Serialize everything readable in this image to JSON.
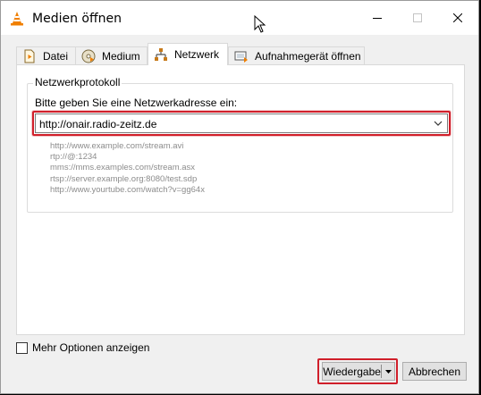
{
  "window": {
    "title": "Medien öffnen",
    "controls": {
      "minimize": "minimize-icon",
      "maximize": "maximize-icon",
      "close": "close-icon"
    }
  },
  "tabs": [
    {
      "label": "Datei",
      "icon": "file-icon",
      "selected": false
    },
    {
      "label": "Medium",
      "icon": "disc-icon",
      "selected": false
    },
    {
      "label": "Netzwerk",
      "icon": "network-icon",
      "selected": true
    },
    {
      "label": "Aufnahmegerät öffnen",
      "icon": "capture-device-icon",
      "selected": false
    }
  ],
  "network": {
    "group_label": "Netzwerkprotokoll",
    "prompt": "Bitte geben Sie eine Netzwerkadresse ein:",
    "url_value": "http://onair.radio-zeitz.de",
    "examples": [
      "http://www.example.com/stream.avi",
      "rtp://@:1234",
      "mms://mms.examples.com/stream.asx",
      "rtsp://server.example.org:8080/test.sdp",
      "http://www.yourtube.com/watch?v=gg64x"
    ]
  },
  "options": {
    "more_options_label": "Mehr Optionen anzeigen",
    "more_options_checked": false
  },
  "buttons": {
    "play_label": "Wiedergabe",
    "cancel_label": "Abbrechen"
  },
  "colors": {
    "highlight": "#d01f2a",
    "vlc_orange": "#f07f00",
    "example_text": "#8c8c8c"
  }
}
